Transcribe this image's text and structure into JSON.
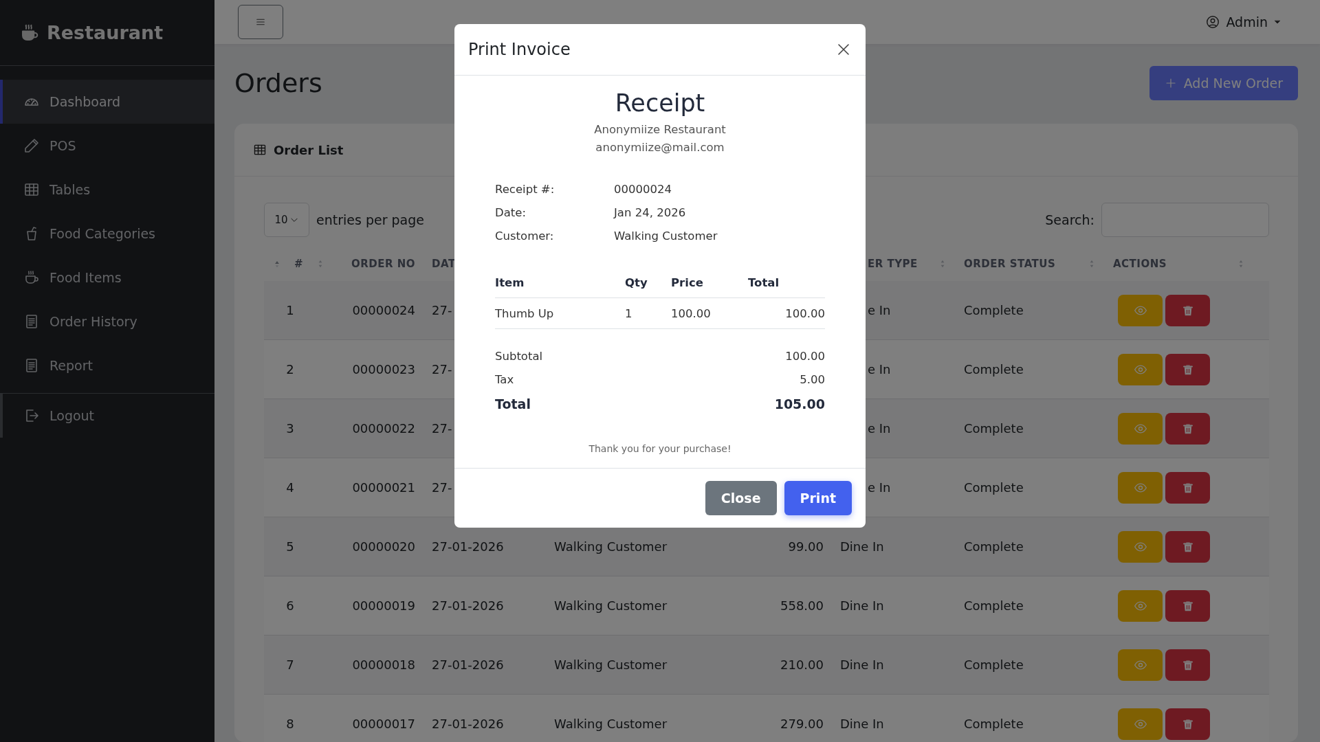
{
  "sidebar": {
    "brand": "Restaurant",
    "items": [
      {
        "label": "Dashboard",
        "selected": true
      },
      {
        "label": "POS",
        "selected": false
      },
      {
        "label": "Tables",
        "selected": false
      },
      {
        "label": "Food Categories",
        "selected": false
      },
      {
        "label": "Food Items",
        "selected": false
      },
      {
        "label": "Order History",
        "selected": false
      },
      {
        "label": "Report",
        "selected": false
      }
    ],
    "footer_items": [
      {
        "label": "Logout",
        "selected": false
      }
    ]
  },
  "header": {
    "user": "Admin"
  },
  "page": {
    "title": "Orders",
    "add_button": "Add New Order"
  },
  "card": {
    "title": "Order List",
    "page_size": "10",
    "page_size_label": "entries per page",
    "search_label": "Search:",
    "columns": [
      {
        "label": "#"
      },
      {
        "label": "ORDER NO"
      },
      {
        "label": "DAT"
      },
      {},
      {},
      {
        "label": "ER TYPE"
      },
      {
        "label": "ORDER STATUS"
      },
      {
        "label": "ACTIONS"
      }
    ],
    "rows": [
      {
        "no": "1",
        "order_no": "00000024",
        "date": "27-",
        "type": "e In",
        "status": "Complete"
      },
      {
        "no": "2",
        "order_no": "00000023",
        "date": "27-",
        "type": "e In",
        "status": "Complete"
      },
      {
        "no": "3",
        "order_no": "00000022",
        "date": "27-",
        "type": "e In",
        "status": "Complete"
      },
      {
        "no": "4",
        "order_no": "00000021",
        "date": "27-",
        "type": "e In",
        "status": "Complete"
      },
      {
        "no": "5",
        "order_no": "00000020",
        "date": "27-01-2026",
        "customer": "Walking Customer",
        "total": "99.00",
        "type": "Dine In",
        "status": "Complete"
      },
      {
        "no": "6",
        "order_no": "00000019",
        "date": "27-01-2026",
        "customer": "Walking Customer",
        "total": "558.00",
        "type": "Dine In",
        "status": "Complete"
      },
      {
        "no": "7",
        "order_no": "00000018",
        "date": "27-01-2026",
        "customer": "Walking Customer",
        "total": "210.00",
        "type": "Dine In",
        "status": "Complete"
      },
      {
        "no": "8",
        "order_no": "00000017",
        "date": "27-01-2026",
        "customer": "Walking Customer",
        "total": "279.00",
        "type": "Dine In",
        "status": "Complete"
      }
    ]
  },
  "dialog": {
    "title": "Print Invoice",
    "receipt": {
      "heading": "Receipt",
      "restaurant": "Anonymiize Restaurant",
      "email": "anonymiize@mail.com",
      "info": [
        {
          "label": "Receipt #:",
          "value": "00000024"
        },
        {
          "label": "Date:",
          "value": "Jan 24, 2026"
        },
        {
          "label": "Customer:",
          "value": "Walking Customer"
        }
      ],
      "columns": [
        "Item",
        "Qty",
        "Price",
        "Total"
      ],
      "items": [
        {
          "item": "Thumb Up",
          "qty": "1",
          "price": "100.00",
          "total": "100.00"
        }
      ],
      "summary": [
        {
          "label": "Subtotal",
          "value": "100.00",
          "kind": "line"
        },
        {
          "label": "Tax",
          "value": "5.00",
          "kind": "line"
        },
        {
          "label": "Total",
          "value": "105.00",
          "kind": "grand"
        }
      ],
      "note": "Thank you for your purchase!"
    },
    "buttons": [
      {
        "label": "Close",
        "kind": "secondary"
      },
      {
        "label": "Print",
        "kind": "primary"
      }
    ]
  }
}
